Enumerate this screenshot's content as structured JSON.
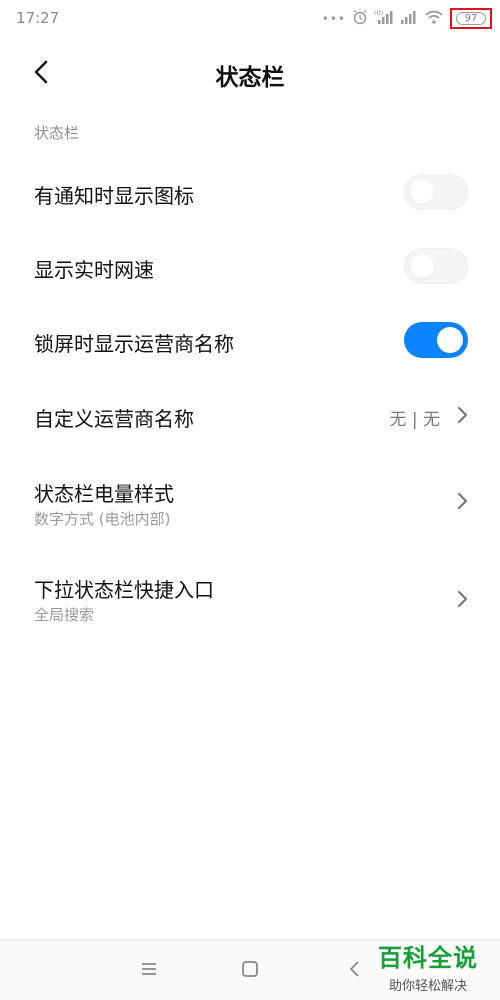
{
  "status_bar": {
    "time": "17:27",
    "battery": "97",
    "icons": [
      "more-dots-icon",
      "alarm-icon",
      "hd-signal-icon",
      "signal-icon",
      "wifi-icon",
      "battery-icon"
    ]
  },
  "header": {
    "title": "状态栏",
    "back_icon": "chevron-left-icon"
  },
  "section": {
    "title": "状态栏"
  },
  "rows": [
    {
      "label": "有通知时显示图标",
      "type": "toggle",
      "on": false
    },
    {
      "label": "显示实时网速",
      "type": "toggle",
      "on": false
    },
    {
      "label": "锁屏时显示运营商名称",
      "type": "toggle",
      "on": true
    },
    {
      "label": "自定义运营商名称",
      "type": "link",
      "value": "无 | 无"
    },
    {
      "label": "状态栏电量样式",
      "type": "link",
      "sub": "数字方式 (电池内部)"
    },
    {
      "label": "下拉状态栏快捷入口",
      "type": "link",
      "sub": "全局搜索"
    }
  ],
  "nav": {
    "icons": [
      "menu-icon",
      "home-icon",
      "back-icon"
    ]
  },
  "watermark": {
    "main": "百科全说",
    "sub": "助你轻松解决"
  },
  "colors": {
    "accent": "#0d84ff",
    "highlight": "#e0141f",
    "watermark": "#1a9e3a"
  }
}
